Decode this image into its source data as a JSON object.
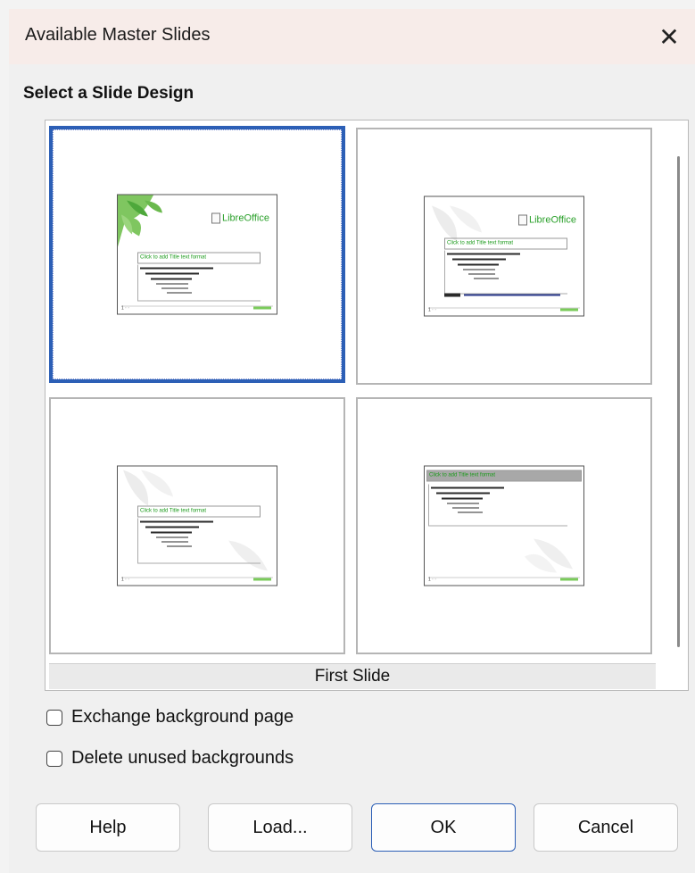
{
  "window": {
    "title": "Available Master Slides",
    "close_icon": "close-icon"
  },
  "section": {
    "title": "Select a Slide Design"
  },
  "designs": [
    {
      "selected": true,
      "thumbnail": {
        "logo": "LibreOffice",
        "title_text": "Click to add Title text format"
      }
    },
    {
      "selected": false,
      "thumbnail": {
        "logo": "LibreOffice",
        "title_text": "Click to add Title text format"
      }
    },
    {
      "selected": false,
      "thumbnail": {
        "logo": "",
        "title_text": "Click to add Title text format"
      }
    },
    {
      "selected": false,
      "thumbnail": {
        "logo": "",
        "title_text": "Click to add Title text format"
      }
    }
  ],
  "selected_design_name": "First Slide",
  "options": {
    "exchange_background": {
      "label": "Exchange background page",
      "checked": false
    },
    "delete_unused": {
      "label": "Delete unused backgrounds",
      "checked": false
    }
  },
  "buttons": {
    "help": "Help",
    "load": "Load...",
    "ok": "OK",
    "cancel": "Cancel"
  },
  "colors": {
    "selection": "#2c5fb6",
    "titlebar": "#f7ece9",
    "accent_green": "#2aa02a"
  }
}
